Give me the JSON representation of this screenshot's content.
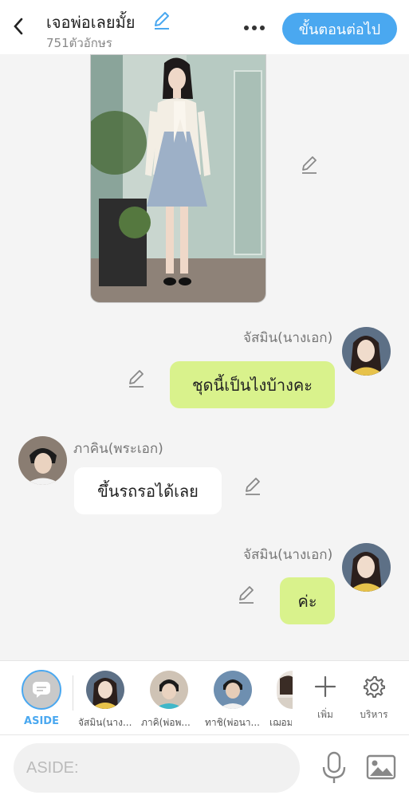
{
  "header": {
    "title": "เจอพ่อเลยมั้ย",
    "char_count": "751ตัวอักษร",
    "next_label": "ขั้นตอนต่อไป",
    "back_icon": "chevron-left-icon",
    "more_icon": "more-horizontal-icon",
    "edit_icon": "pencil-icon"
  },
  "messages": [
    {
      "type": "image",
      "description_icon": "pencil-icon"
    },
    {
      "side": "right",
      "sender": "จัสมิน(นางเอก)",
      "text": "ชุดนี้เป็นไงบ้างคะ"
    },
    {
      "side": "left",
      "sender": "ภาคิน(พระเอก)",
      "text": "ขึ้นรถรอได้เลย"
    },
    {
      "side": "right",
      "sender": "จัสมิน(นางเอก)",
      "text": "ค่ะ"
    }
  ],
  "characters": {
    "aside_label": "ASIDE",
    "items": [
      {
        "name": "จัสมิน(นาง..."
      },
      {
        "name": "ภาคิ(พ่อพ..."
      },
      {
        "name": "ทาชิ(พ่อนา..."
      },
      {
        "name": "เฌอม"
      }
    ],
    "add_label": "เพิ่ม",
    "manage_label": "บริหาร"
  },
  "input": {
    "placeholder": "ASIDE:"
  },
  "colors": {
    "accent": "#4aa8f0",
    "bubble_green": "#d9f28c",
    "background": "#f4f4f4"
  }
}
